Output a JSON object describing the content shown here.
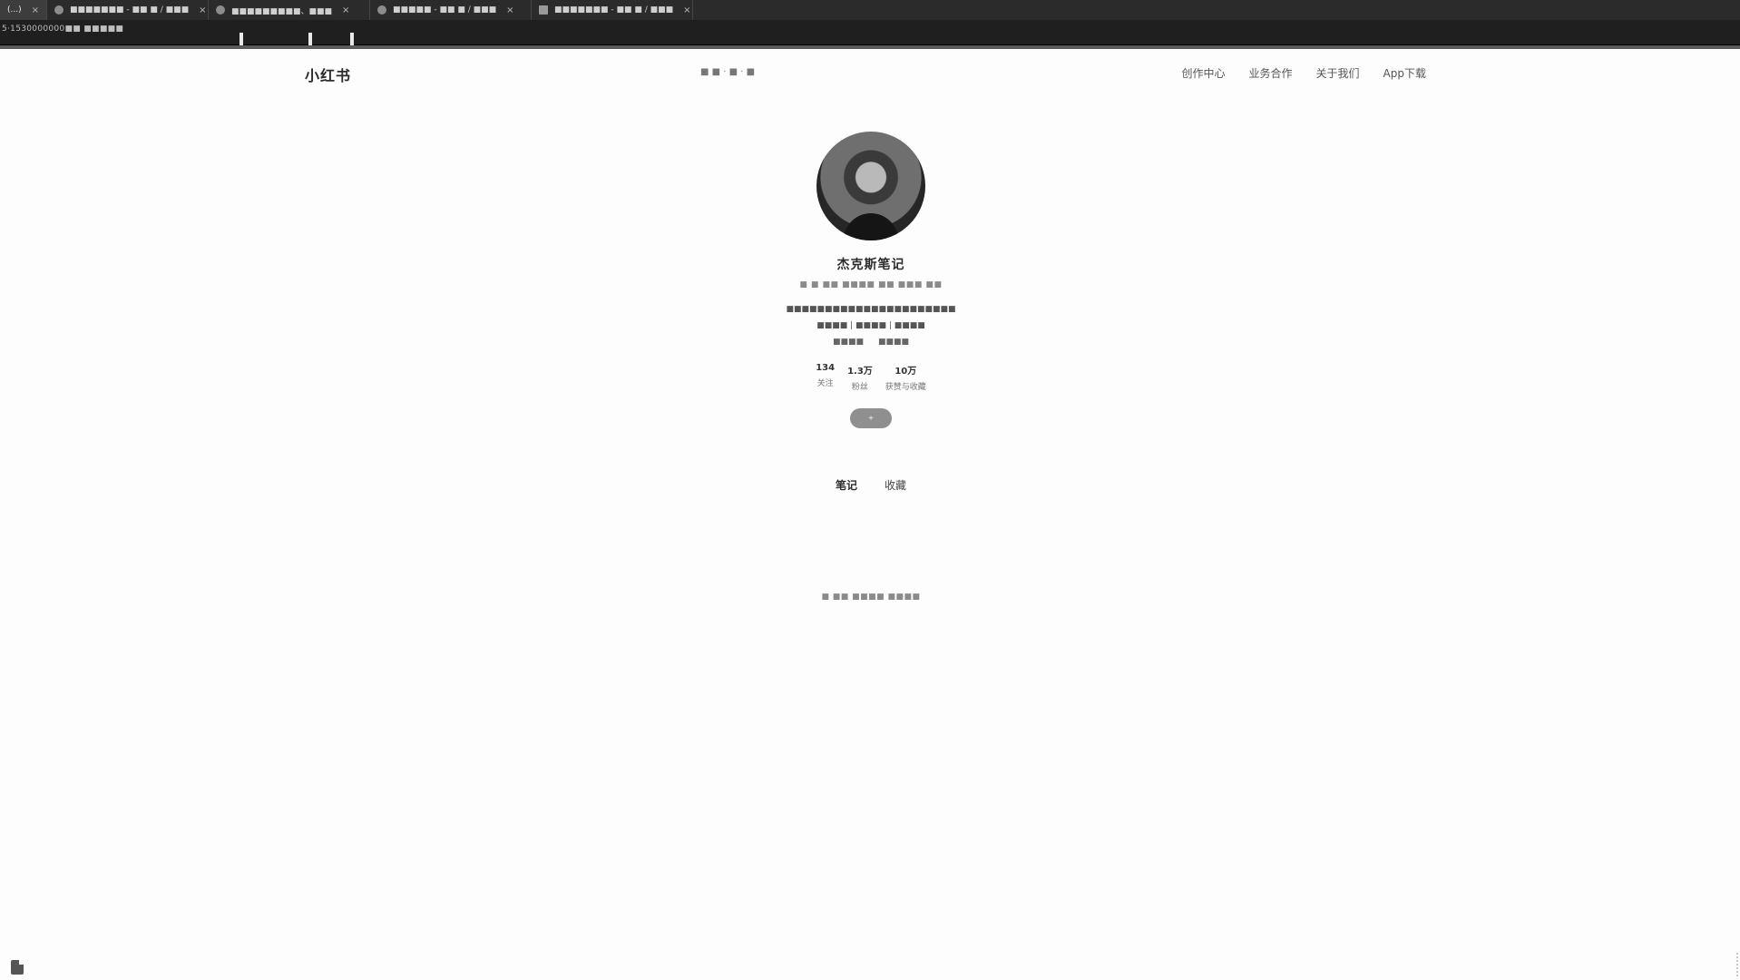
{
  "browser": {
    "tabs": [
      {
        "label": "(...)",
        "active": true
      },
      {
        "label": "■■■■■■■ - ■■ ■ / ■■■",
        "active": false
      },
      {
        "label": "■■■■■■■■■、■■■",
        "active": false
      },
      {
        "label": "■■■■■ - ■■ ■ / ■■■",
        "active": false
      },
      {
        "label": "■■■■■■■ - ■■ ■ / ■■■",
        "active": false
      }
    ],
    "close_glyph": "×",
    "url": "5·1530000000■■ ■■■■■"
  },
  "header": {
    "logo": "小红书",
    "center_text": "■ ■ · ■ · ■",
    "nav": [
      "创作中心",
      "业务合作",
      "关于我们",
      "App下载"
    ]
  },
  "profile": {
    "name": "杰克斯笔记",
    "meta": "■ ■ ■■  ■■■■  ■■  ■■■  ■■",
    "bio_line1": "■■■■■■■■■■■■■■■■■■■■■■",
    "bio_line2": "■■■■ | ■■■■ | ■■■■",
    "tags": [
      "■■■■",
      "■■■■"
    ],
    "stats": [
      {
        "num": "134",
        "label": "关注"
      },
      {
        "num": "1.3万",
        "label": "粉丝"
      },
      {
        "num": "10万",
        "label": "获赞与收藏"
      }
    ],
    "follow_label": "+"
  },
  "content_tabs": [
    {
      "label": "笔记",
      "active": true
    },
    {
      "label": "收藏",
      "active": false
    }
  ],
  "empty_text": "■ ■■ ■■■■ ■■■■"
}
